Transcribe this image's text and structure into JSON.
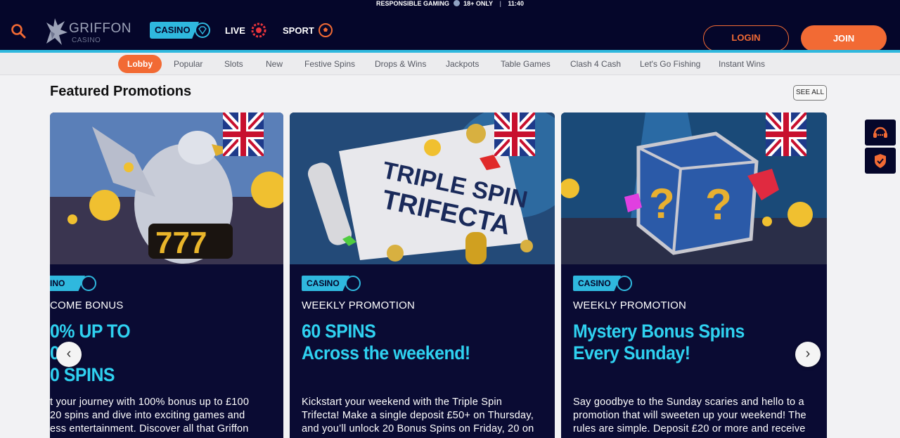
{
  "topbar": {
    "responsible": "RESPONSIBLE GAMING",
    "age": "18+ ONLY",
    "divider": "|",
    "time": "11:40"
  },
  "header": {
    "logo_name": "GRIFFON",
    "logo_sub": "CASINO",
    "nav": {
      "casino": "CASINO",
      "live": "LIVE",
      "sport": "SPORT"
    },
    "login": "LOGIN",
    "join": "JOIN"
  },
  "categories": [
    "Lobby",
    "Popular",
    "Slots",
    "New",
    "Festive Spins",
    "Drops & Wins",
    "Jackpots",
    "Table Games",
    "Clash 4 Cash",
    "Let's Go Fishing",
    "Instant Wins"
  ],
  "section": {
    "title": "Featured Promotions",
    "see_all": "SEE ALL"
  },
  "cards": [
    {
      "tag": "INO",
      "subtitle": "COME BONUS",
      "title_lines": [
        "0% UP TO",
        "0",
        "0 SPINS"
      ],
      "text_lines": [
        "t your journey with 100% bonus up to £100",
        "20 spins and dive into exciting games and",
        "ess entertainment. Discover all that Griffon"
      ]
    },
    {
      "tag": "CASINO",
      "subtitle": "WEEKLY PROMOTION",
      "title_lines": [
        "60 SPINS",
        "Across the weekend!"
      ],
      "text_lines": [
        "Kickstart your weekend with the Triple Spin",
        "Trifecta! Make a single deposit £50+ on Thursday,",
        "and you’ll unlock 20 Bonus Spins on Friday, 20 on"
      ],
      "image_text": [
        "TRIPLE SPIN",
        "TRIFECTA"
      ]
    },
    {
      "tag": "CASINO",
      "subtitle": "WEEKLY PROMOTION",
      "title_lines": [
        "Mystery Bonus Spins",
        "Every Sunday!"
      ],
      "text_lines": [
        "Say goodbye to the Sunday scaries and hello to a",
        "promotion that will sweeten up your weekend! The",
        "rules are simple. Deposit £20 or more and receive"
      ]
    }
  ],
  "arrows": {
    "prev": "‹",
    "next": "›"
  },
  "colors": {
    "navy": "#05062a",
    "accent": "#2fb8de",
    "orange": "#f26a34",
    "card_title": "#2fd1f0"
  }
}
